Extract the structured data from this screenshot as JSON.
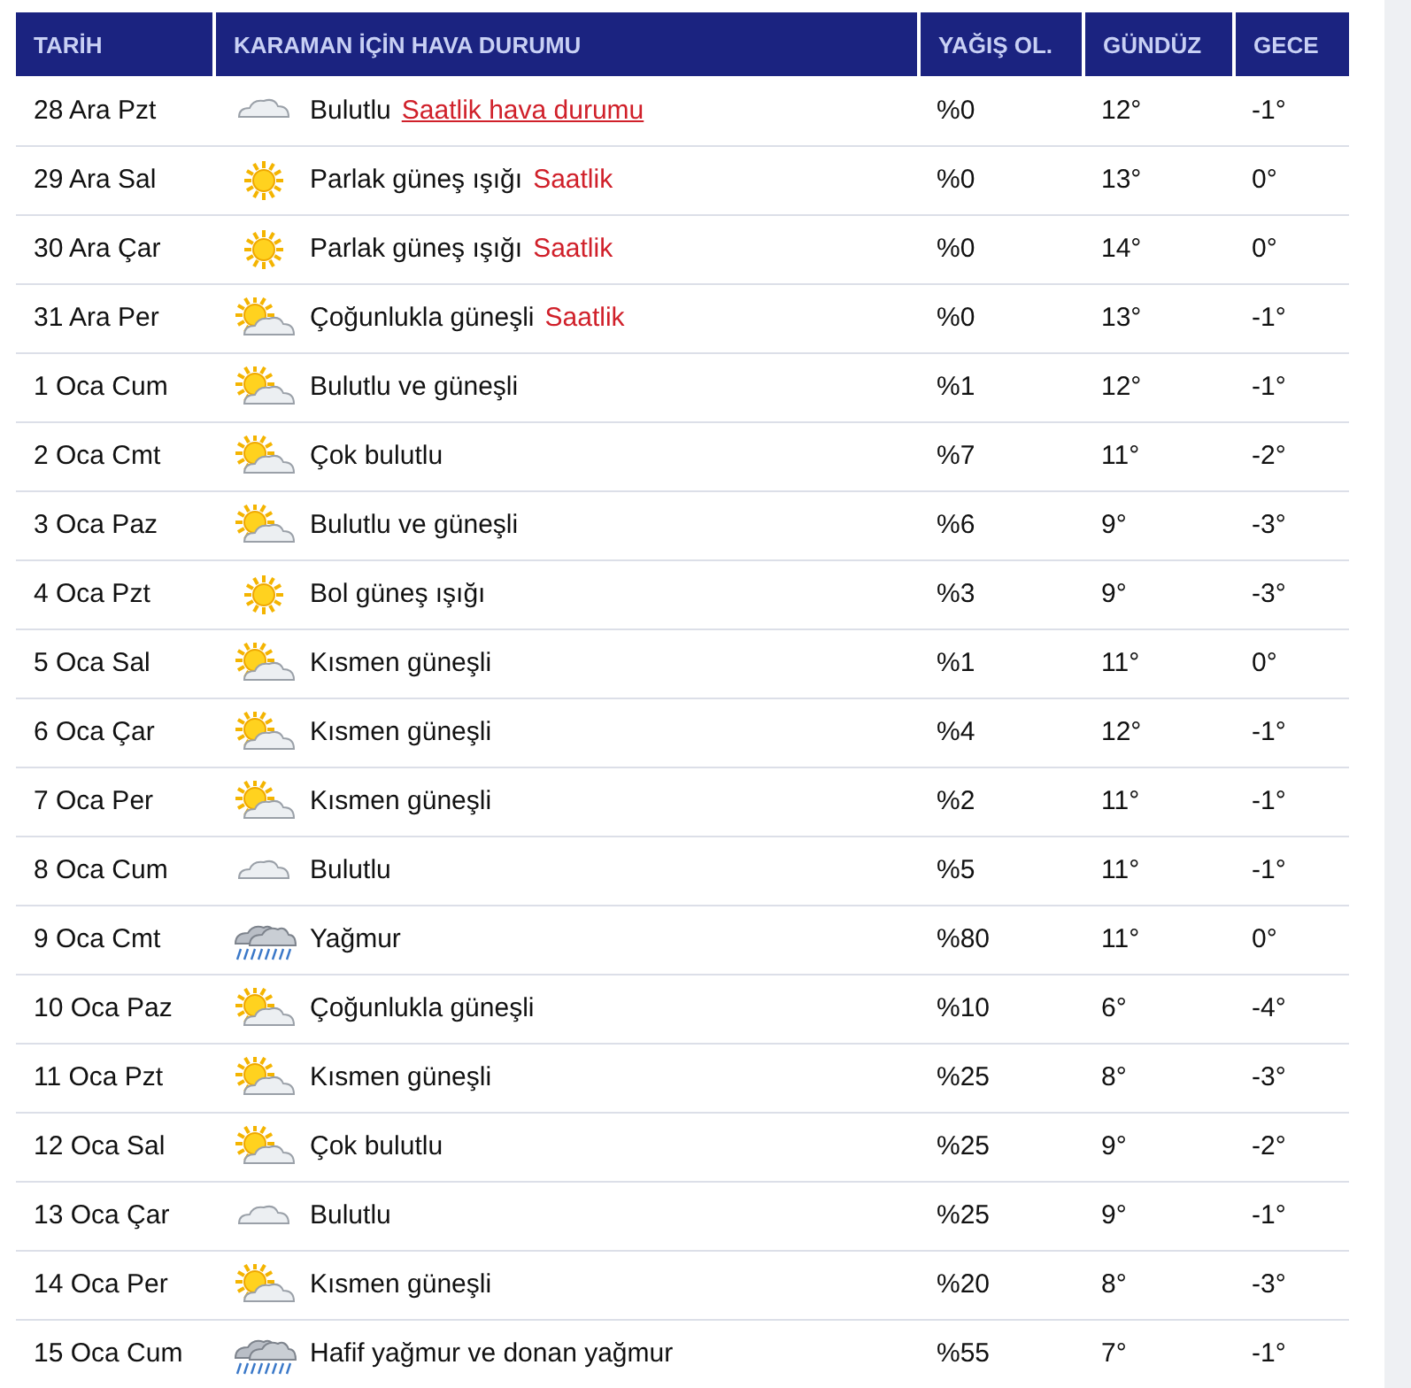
{
  "table": {
    "columns": [
      "TARİH",
      "KARAMAN İÇİN HAVA DURUMU",
      "YAĞIŞ OL.",
      "GÜNDÜZ",
      "GECE"
    ],
    "rows": [
      {
        "date": "28 Ara Pzt",
        "kind": "cloud",
        "description": "Bulutlu",
        "link": {
          "text": "Saatlik hava durumu",
          "underlined": true
        },
        "precip": "%0",
        "day": "12°",
        "night": "-1°"
      },
      {
        "date": "29 Ara Sal",
        "kind": "sun",
        "description": "Parlak güneş ışığı",
        "link": {
          "text": "Saatlik",
          "underlined": false
        },
        "precip": "%0",
        "day": "13°",
        "night": "0°"
      },
      {
        "date": "30 Ara Çar",
        "kind": "sun",
        "description": "Parlak güneş ışığı",
        "link": {
          "text": "Saatlik",
          "underlined": false
        },
        "precip": "%0",
        "day": "14°",
        "night": "0°"
      },
      {
        "date": "31 Ara Per",
        "kind": "suncloud",
        "description": "Çoğunlukla güneşli",
        "link": {
          "text": "Saatlik",
          "underlined": false
        },
        "precip": "%0",
        "day": "13°",
        "night": "-1°"
      },
      {
        "date": "1 Oca Cum",
        "kind": "suncloud",
        "description": "Bulutlu ve güneşli",
        "precip": "%1",
        "day": "12°",
        "night": "-1°"
      },
      {
        "date": "2 Oca Cmt",
        "kind": "suncloud",
        "description": "Çok bulutlu",
        "precip": "%7",
        "day": "11°",
        "night": "-2°"
      },
      {
        "date": "3 Oca Paz",
        "kind": "suncloud",
        "description": "Bulutlu ve güneşli",
        "precip": "%6",
        "day": "9°",
        "night": "-3°"
      },
      {
        "date": "4 Oca Pzt",
        "kind": "sun",
        "description": "Bol güneş ışığı",
        "precip": "%3",
        "day": "9°",
        "night": "-3°"
      },
      {
        "date": "5 Oca Sal",
        "kind": "suncloud",
        "description": "Kısmen güneşli",
        "precip": "%1",
        "day": "11°",
        "night": "0°"
      },
      {
        "date": "6 Oca Çar",
        "kind": "suncloud",
        "description": "Kısmen güneşli",
        "precip": "%4",
        "day": "12°",
        "night": "-1°"
      },
      {
        "date": "7 Oca Per",
        "kind": "suncloud",
        "description": "Kısmen güneşli",
        "precip": "%2",
        "day": "11°",
        "night": "-1°"
      },
      {
        "date": "8 Oca Cum",
        "kind": "cloud",
        "description": "Bulutlu",
        "precip": "%5",
        "day": "11°",
        "night": "-1°"
      },
      {
        "date": "9 Oca Cmt",
        "kind": "rain",
        "description": "Yağmur",
        "precip": "%80",
        "day": "11°",
        "night": "0°"
      },
      {
        "date": "10 Oca Paz",
        "kind": "suncloud",
        "description": "Çoğunlukla güneşli",
        "precip": "%10",
        "day": "6°",
        "night": "-4°"
      },
      {
        "date": "11 Oca Pzt",
        "kind": "suncloud",
        "description": "Kısmen güneşli",
        "precip": "%25",
        "day": "8°",
        "night": "-3°"
      },
      {
        "date": "12 Oca Sal",
        "kind": "suncloud",
        "description": "Çok bulutlu",
        "precip": "%25",
        "day": "9°",
        "night": "-2°"
      },
      {
        "date": "13 Oca Çar",
        "kind": "cloud",
        "description": "Bulutlu",
        "precip": "%25",
        "day": "9°",
        "night": "-1°"
      },
      {
        "date": "14 Oca Per",
        "kind": "suncloud",
        "description": "Kısmen güneşli",
        "precip": "%20",
        "day": "8°",
        "night": "-3°"
      },
      {
        "date": "15 Oca Cum",
        "kind": "rain",
        "description": "Hafif yağmur ve donan yağmur",
        "precip": "%55",
        "day": "7°",
        "night": "-1°"
      }
    ]
  }
}
